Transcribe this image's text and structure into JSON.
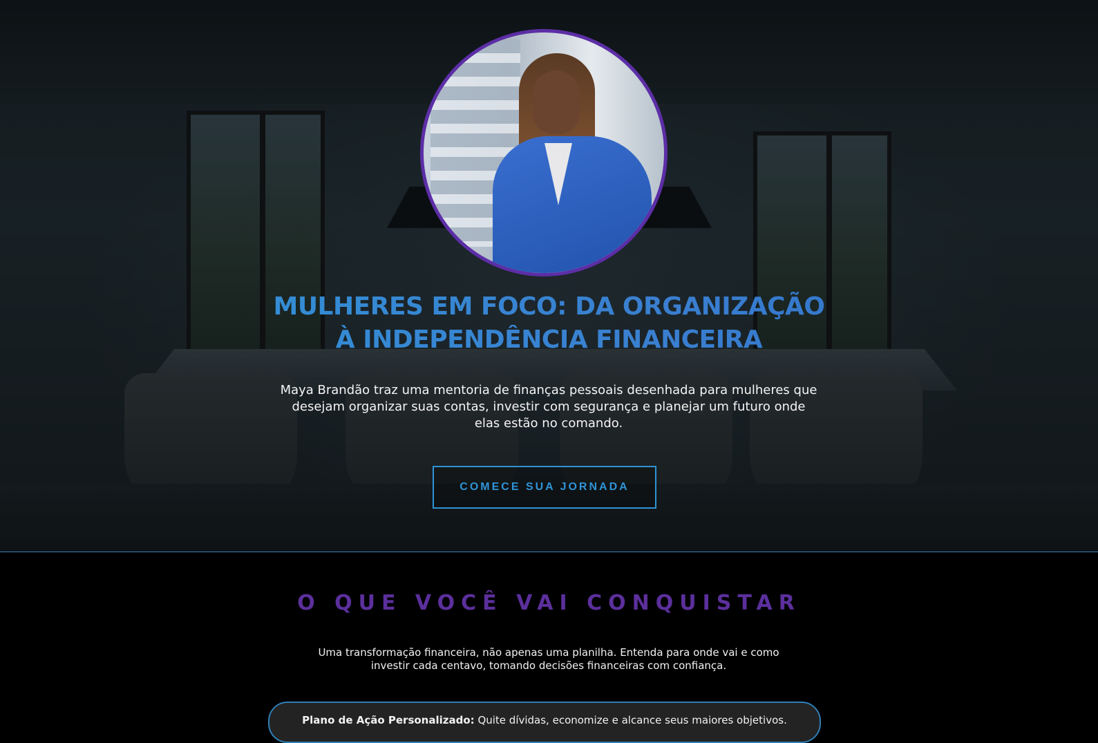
{
  "hero": {
    "title_line1": "MULHERES EM FOCO: DA ORGANIZAÇÃO",
    "title_line2": "À INDEPENDÊNCIA FINANCEIRA",
    "description": "Maya Brandão traz uma mentoria de finanças pessoais desenhada para mulheres que desejam organizar suas contas, investir com segurança e planejar um futuro onde elas estão no comando.",
    "cta_label": "COMECE SUA JORNADA"
  },
  "section": {
    "title": "O QUE VOCÊ VAI CONQUISTAR",
    "description": "Uma transformação financeira, não apenas uma planilha. Entenda para onde vai e como investir cada centavo, tomando decisões financeiras com confiança.",
    "features": [
      {
        "label": "Plano de Ação Personalizado:",
        "text": " Quite dívidas, economize e alcance seus maiores objetivos."
      }
    ]
  },
  "colors": {
    "accent_blue": "#2f94d6",
    "accent_purple": "#5b2f9c",
    "background": "#000000"
  }
}
